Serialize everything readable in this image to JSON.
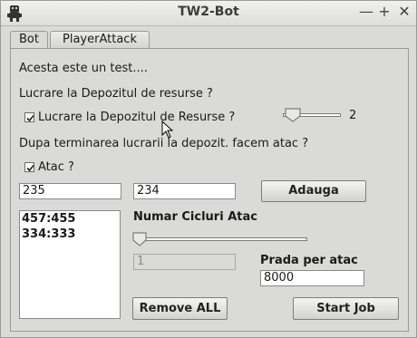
{
  "window": {
    "title": "TW2-Bot",
    "controls": {
      "minimize": "—",
      "maximize": "+",
      "close": "✕"
    }
  },
  "tabs": [
    {
      "label": "Bot",
      "active": true
    },
    {
      "label": "PlayerAttack",
      "active": false
    }
  ],
  "bot": {
    "test_label": "Acesta este un test....",
    "depot_question": "Lucrare la Depozitul de resurse ?",
    "depot_checkbox": {
      "label": "Lucrare la Depozitul de Resurse ?",
      "checked": true
    },
    "depot_slider": {
      "value": 2,
      "value_label": "2"
    },
    "after_question": "Dupa terminarea lucrarii la depozit. facem atac ?",
    "attack_checkbox": {
      "label": "Atac ?",
      "checked": true
    },
    "coord_x": {
      "value": "235"
    },
    "coord_y": {
      "value": "234"
    },
    "add_button": "Adauga",
    "targets": [
      "457:455",
      "334:333"
    ],
    "cycles_label": "Numar Cicluri Atac",
    "cycles_slider": {
      "value": 1
    },
    "cycles_field": {
      "value": "1"
    },
    "loot_label": "Prada per atac",
    "loot_field": {
      "value": "8000"
    },
    "remove_all_button": "Remove ALL",
    "start_job_button": "Start Job"
  },
  "icons": {
    "app": "robot-icon",
    "checkmark": "checkmark-icon",
    "cursor": "mouse-pointer-icon"
  }
}
